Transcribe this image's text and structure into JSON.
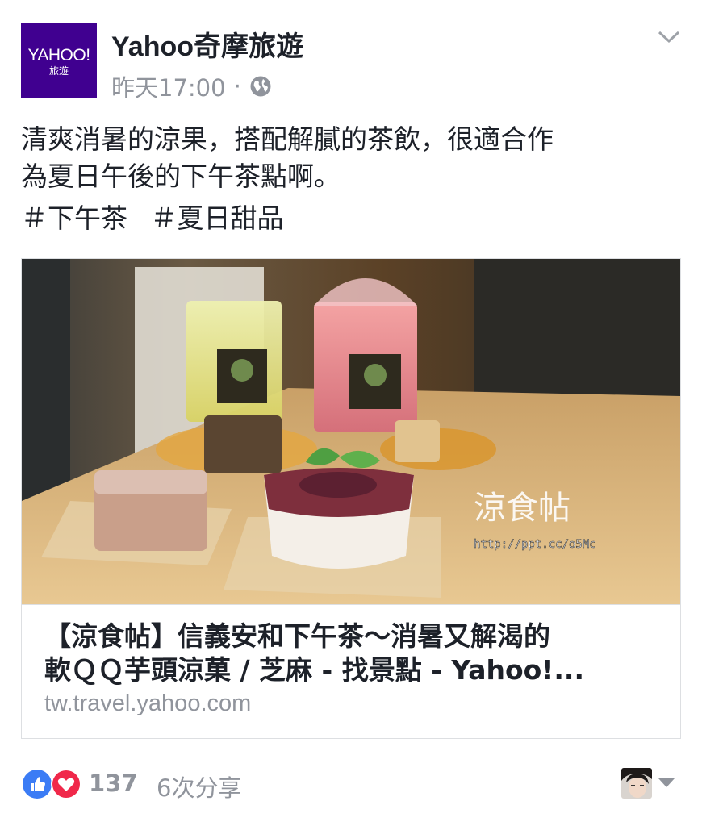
{
  "post": {
    "page_name": "Yahoo奇摩旅遊",
    "avatar_logo": "YAHOO!",
    "avatar_sub": "旅遊",
    "timestamp": "昨天17:00",
    "separator": "·",
    "privacy_icon": "globe-icon",
    "menu_icon": "chevron-down-icon",
    "text_line1": "清爽消暑的涼果，搭配解膩的茶飲，很適合作",
    "text_line2": "為夏日午後的下午茶點啊。",
    "hashtags": [
      "＃下午茶",
      "＃夏日甜品"
    ]
  },
  "link_card": {
    "photo_watermark": "涼食帖",
    "photo_url_text": "http://ppt.cc/o5Mc",
    "title_line1": "【涼食帖】信義安和下午茶～消暑又解渴的",
    "title_line2": "軟ＱＱ芋頭涼菓 / 芝麻 - 找景點 - Yahoo!...",
    "domain": "tw.travel.yahoo.com"
  },
  "footer": {
    "reaction_icons": [
      "like-icon",
      "love-icon"
    ],
    "reaction_count": "137",
    "share_count": "6次分享"
  },
  "colors": {
    "yahoo_purple": "#400090",
    "like_blue": "#3b7cf5",
    "love_red": "#f0284a",
    "meta_gray": "#90949c"
  }
}
